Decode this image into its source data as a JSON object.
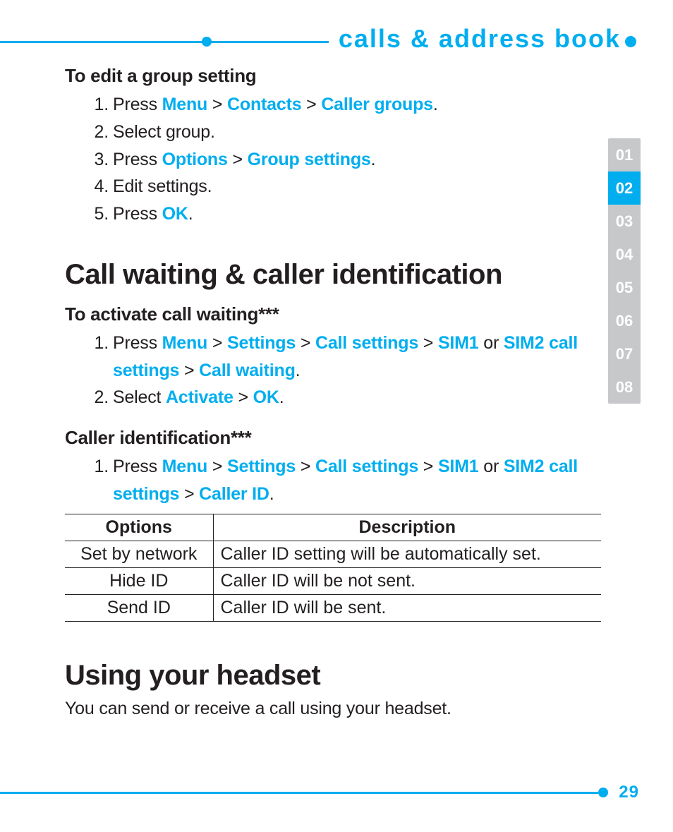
{
  "header": {
    "title": "calls & address book"
  },
  "tabs": {
    "items": [
      "01",
      "02",
      "03",
      "04",
      "05",
      "06",
      "07",
      "08"
    ],
    "active_index": 1
  },
  "section_edit_group": {
    "heading": "To edit a group setting",
    "steps": [
      {
        "n": "1.",
        "pre": "Press ",
        "kw": [
          "Menu",
          "Contacts",
          "Caller groups"
        ],
        "post": "."
      },
      {
        "n": "2.",
        "text": "Select group."
      },
      {
        "n": "3.",
        "pre": "Press ",
        "kw": [
          "Options",
          "Group settings"
        ],
        "post": "."
      },
      {
        "n": "4.",
        "text": "Edit settings."
      },
      {
        "n": "5.",
        "pre": "Press ",
        "kw": [
          "OK"
        ],
        "post": "."
      }
    ]
  },
  "section_callwait": {
    "heading_main": "Call waiting & caller identification",
    "sub1": {
      "heading": "To activate call waiting***",
      "step1": {
        "n": "1.",
        "pre": "Press ",
        "a": "Menu",
        "b": "Settings",
        "c": "Call settings",
        "d": "SIM1",
        "or": " or ",
        "e": "SIM2 call settings",
        "f": "Call waiting",
        "post": "."
      },
      "step2": {
        "n": "2.",
        "pre": "Select ",
        "a": "Activate",
        "b": "OK",
        "post": "."
      }
    },
    "sub2": {
      "heading": "Caller identification***",
      "step1": {
        "n": "1.",
        "pre": "Press ",
        "a": "Menu",
        "b": "Settings",
        "c": "Call settings",
        "d": "SIM1",
        "or": " or ",
        "e": "SIM2 call settings",
        "f": "Caller ID",
        "post": "."
      }
    }
  },
  "table": {
    "head": {
      "c1": "Options",
      "c2": "Description"
    },
    "rows": [
      {
        "c1": "Set by network",
        "c2": "Caller ID setting will be automatically set."
      },
      {
        "c1": "Hide ID",
        "c2": "Caller ID will be not sent."
      },
      {
        "c1": "Send ID",
        "c2": "Caller ID will be sent."
      }
    ]
  },
  "section_headset": {
    "heading_main": "Using your headset",
    "lead": "You can send or receive a call using your headset."
  },
  "footer": {
    "page": "29"
  },
  "sep": " > "
}
